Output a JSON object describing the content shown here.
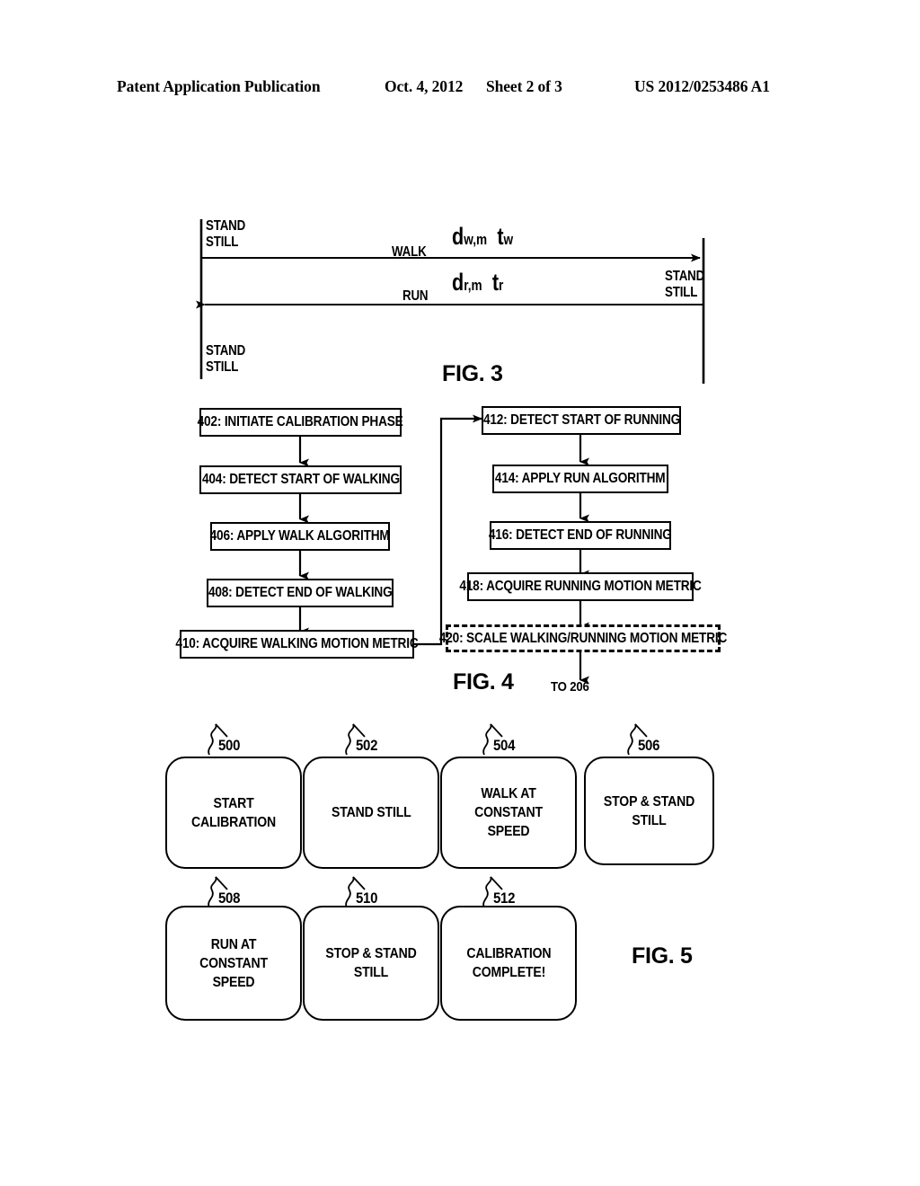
{
  "header": {
    "publication": "Patent Application Publication",
    "date": "Oct. 4, 2012",
    "sheet": "Sheet 2 of 3",
    "patent_number": "US 2012/0253486 A1"
  },
  "fig3": {
    "caption": "FIG. 3",
    "stand_still_top_left": "STAND\nSTILL",
    "stand_still_bottom_left": "STAND\nSTILL",
    "stand_still_right": "STAND\nSTILL",
    "walk_label": "WALK",
    "run_label": "RUN",
    "walk_symbol_d": "d",
    "walk_symbol_d_sub": "w,m",
    "walk_symbol_t": "t",
    "walk_symbol_t_sub": "w",
    "run_symbol_d": "d",
    "run_symbol_d_sub": "r,m",
    "run_symbol_t": "t",
    "run_symbol_t_sub": "r"
  },
  "fig4": {
    "caption": "FIG. 4",
    "to_label": "TO 206",
    "left_column": [
      {
        "id": "402",
        "text": "402: INITIATE CALIBRATION PHASE"
      },
      {
        "id": "404",
        "text": "404: DETECT START OF WALKING"
      },
      {
        "id": "406",
        "text": "406: APPLY WALK ALGORITHM"
      },
      {
        "id": "408",
        "text": "408: DETECT END OF WALKING"
      },
      {
        "id": "410",
        "text": "410: ACQUIRE WALKING MOTION METRIC"
      }
    ],
    "right_column": [
      {
        "id": "412",
        "text": "412: DETECT START OF RUNNING"
      },
      {
        "id": "414",
        "text": "414: APPLY RUN ALGORITHM"
      },
      {
        "id": "416",
        "text": "416: DETECT END OF RUNNING"
      },
      {
        "id": "418",
        "text": "418: ACQUIRE RUNNING MOTION METRIC"
      },
      {
        "id": "420",
        "text": "420: SCALE WALKING/RUNNING MOTION METRIC",
        "style": "dashed"
      }
    ]
  },
  "fig5": {
    "caption": "FIG. 5",
    "screens": [
      {
        "ref": "500",
        "line1": "START CALIBRATION",
        "line2": ""
      },
      {
        "ref": "502",
        "line1": "STAND STILL",
        "line2": ""
      },
      {
        "ref": "504",
        "line1": "WALK AT CONSTANT",
        "line2": "SPEED"
      },
      {
        "ref": "506",
        "line1": "STOP & STAND STILL",
        "line2": ""
      },
      {
        "ref": "508",
        "line1": "RUN AT CONSTANT",
        "line2": "SPEED"
      },
      {
        "ref": "510",
        "line1": "STOP & STAND STILL",
        "line2": ""
      },
      {
        "ref": "512",
        "line1": "CALIBRATION",
        "line2": "COMPLETE!"
      }
    ]
  },
  "colors": {
    "ink": "#000000",
    "paper": "#ffffff"
  }
}
